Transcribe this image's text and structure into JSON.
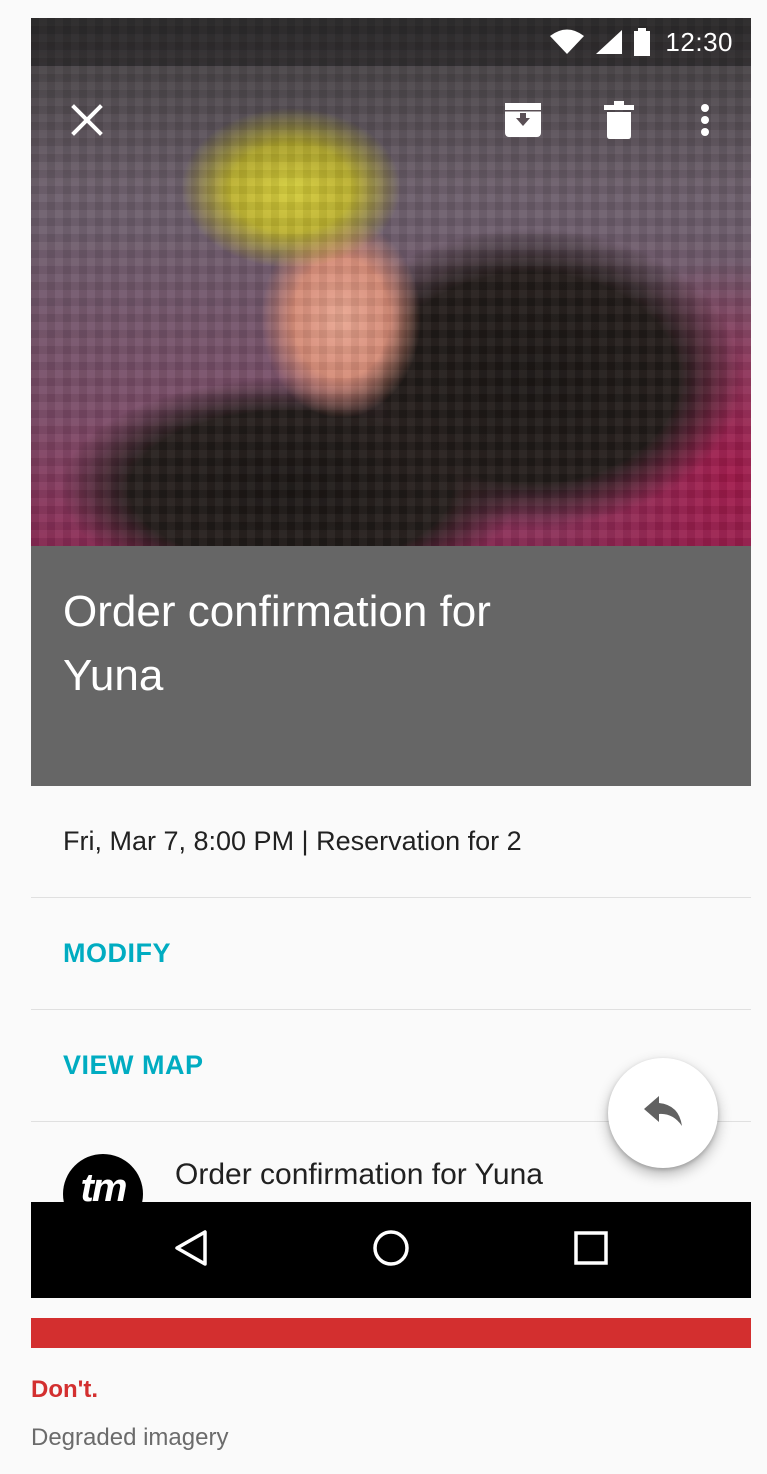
{
  "status_bar": {
    "time": "12:30",
    "icons": [
      "wifi-icon",
      "cell-signal-icon",
      "battery-icon"
    ]
  },
  "toolbar": {
    "icons": [
      "close-icon",
      "archive-icon",
      "delete-icon",
      "more-vert-icon"
    ]
  },
  "email": {
    "title": "Order confirmation for Yuna",
    "reservation": "Fri, Mar 7, 8:00 PM | Reservation for 2",
    "actions": {
      "modify": "MODIFY",
      "view_map": "VIEW MAP"
    },
    "sender": {
      "avatar_text": "tm",
      "subject": "Order confirmation for Yuna"
    }
  },
  "fab": {
    "icon": "reply-icon"
  },
  "nav_bar": {
    "icons": [
      "back-icon",
      "home-icon",
      "recents-icon"
    ]
  },
  "guideline": {
    "verdict": "Don't.",
    "caption": "Degraded imagery",
    "colors": {
      "dont": "#d32f2f",
      "accent": "#00acc1"
    }
  }
}
